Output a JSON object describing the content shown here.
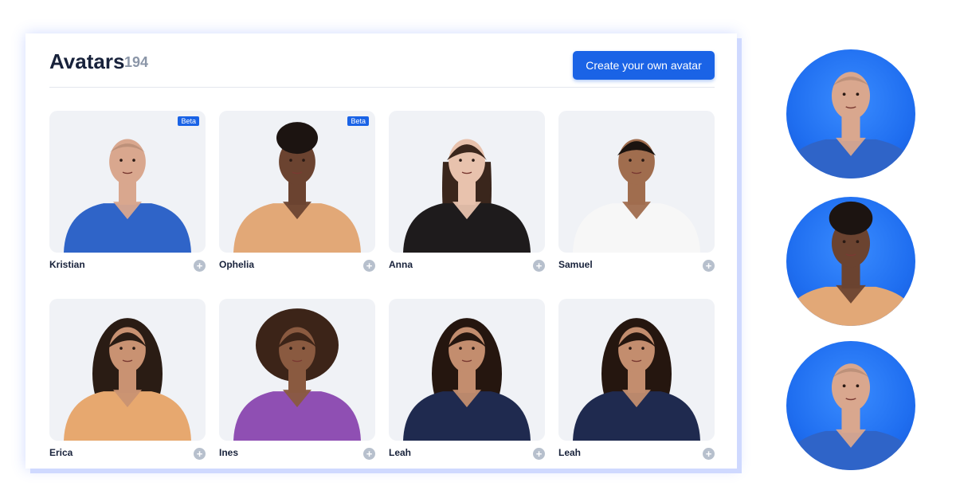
{
  "header": {
    "title": "Avatars",
    "count": "194",
    "create_label": "Create your own avatar"
  },
  "avatars": [
    {
      "name": "Kristian",
      "badge": "Beta",
      "top_color": "#2f64c8",
      "skin": "#d9a78e",
      "hair": "#8a6a55",
      "hair_style": "bald"
    },
    {
      "name": "Ophelia",
      "badge": "Beta",
      "top_color": "#e2a877",
      "skin": "#6b4330",
      "hair": "#1c1411",
      "hair_style": "bun"
    },
    {
      "name": "Anna",
      "badge": "",
      "top_color": "#1e1b1c",
      "skin": "#e8c2ad",
      "hair": "#3a261c",
      "hair_style": "long"
    },
    {
      "name": "Samuel",
      "badge": "",
      "top_color": "#f7f7f7",
      "skin": "#a06d4e",
      "hair": "#1b130f",
      "hair_style": "short"
    },
    {
      "name": "Erica",
      "badge": "",
      "top_color": "#e7a86f",
      "skin": "#c99272",
      "hair": "#2a1c14",
      "hair_style": "curly"
    },
    {
      "name": "Ines",
      "badge": "",
      "top_color": "#8f4fb3",
      "skin": "#8a5a40",
      "hair": "#3c2418",
      "hair_style": "afro"
    },
    {
      "name": "Leah",
      "badge": "",
      "top_color": "#1f2a4f",
      "skin": "#c38d6e",
      "hair": "#25160f",
      "hair_style": "curly"
    },
    {
      "name": "Leah",
      "badge": "",
      "top_color": "#1f2a4f",
      "skin": "#c38d6e",
      "hair": "#25160f",
      "hair_style": "curly"
    }
  ],
  "previews": [
    {
      "avatar": "Kristian",
      "skin": "#d9a78e",
      "hair": "#8a6a55",
      "top_color": "#2f64c8",
      "hair_style": "bald"
    },
    {
      "avatar": "Ophelia",
      "skin": "#6b4330",
      "hair": "#1c1411",
      "top_color": "#e2a877",
      "hair_style": "bun"
    },
    {
      "avatar": "Kristian",
      "skin": "#d9a78e",
      "hair": "#8a6a55",
      "top_color": "#2f64c8",
      "hair_style": "bald"
    }
  ],
  "colors": {
    "accent": "#1a63e6",
    "card_bg": "#f0f2f6",
    "text": "#18223b",
    "muted": "#8b96a8"
  },
  "icons": {
    "add": "plus-icon"
  }
}
